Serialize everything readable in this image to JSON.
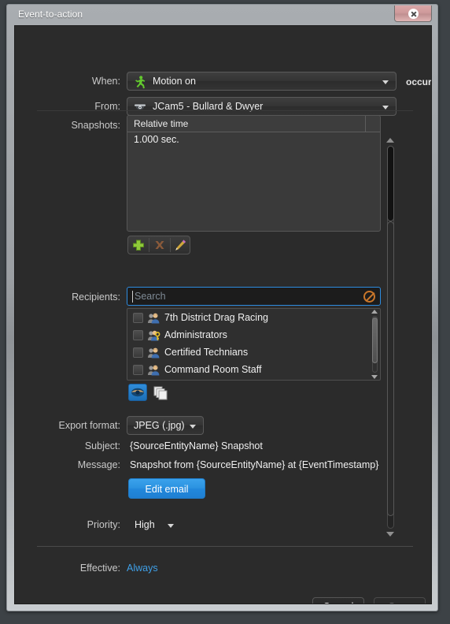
{
  "window": {
    "title": "Event-to-action",
    "close_label": "Close"
  },
  "form": {
    "when_label": "When:",
    "when_value": "Motion on",
    "when_icon": "motion-runner-icon",
    "occurs_label": "occurs",
    "from_label": "From:",
    "from_value": "JCam5 - Bullard & Dwyer",
    "from_icon": "dome-camera-icon",
    "snapshots_label": "Snapshots:",
    "recipients_label": "Recipients:",
    "export_format_label": "Export format:",
    "export_format_value": "JPEG (.jpg)",
    "subject_label": "Subject:",
    "subject_value": "{SourceEntityName} Snapshot",
    "message_label": "Message:",
    "message_value": "Snapshot from {SourceEntityName} at {EventTimestamp}",
    "edit_email_label": "Edit email",
    "priority_label": "Priority:",
    "priority_value": "High",
    "effective_label": "Effective:",
    "effective_value": "Always"
  },
  "snapshots": {
    "columns": [
      "Relative time",
      ""
    ],
    "rows": [
      {
        "relative_time": "1.000 sec."
      }
    ],
    "toolbar": [
      {
        "name": "add-snapshot-button",
        "icon": "plus-icon"
      },
      {
        "name": "delete-snapshot-button",
        "icon": "x-icon"
      },
      {
        "name": "edit-snapshot-button",
        "icon": "pencil-icon"
      }
    ]
  },
  "recipients": {
    "search_placeholder": "Search",
    "search_value": "",
    "clear_icon": "clear-search-icon",
    "items": [
      {
        "label": "7th District Drag Racing",
        "icon": "user-group-icon",
        "checked": false
      },
      {
        "label": "Administrators",
        "icon": "admin-group-key-icon",
        "checked": false
      },
      {
        "label": "Certified Technians",
        "icon": "user-group-icon",
        "checked": false
      },
      {
        "label": "Command Room Staff",
        "icon": "user-group-icon",
        "checked": false
      }
    ],
    "toolbar": [
      {
        "name": "view-toggle-button",
        "icon": "eye-icon",
        "active": true
      },
      {
        "name": "copy-button",
        "icon": "copy-stack-icon",
        "active": false
      }
    ]
  },
  "footer": {
    "cancel_label": "Cancel",
    "save_label": "Save"
  },
  "colors": {
    "accent_blue": "#2b92e0",
    "link_blue": "#3fa0e8",
    "focus_blue": "#2d8ce0",
    "motion_green": "#5ec02c",
    "clear_orange": "#c9762a",
    "close_red": "#cf9a9b"
  }
}
